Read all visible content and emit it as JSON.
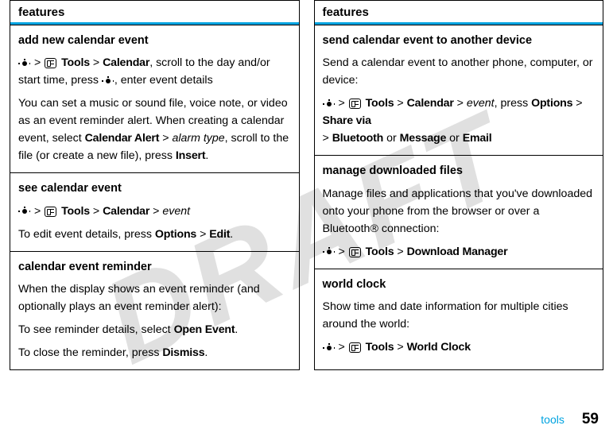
{
  "watermark": "DRAFT",
  "left": {
    "header": "features",
    "sections": [
      {
        "title": "add new calendar event",
        "paras": [
          {
            "type": "path1",
            "t1": "Tools",
            "t2": "Calendar",
            "after": ", scroll to the day and/or start time, press ",
            "navAfter": true,
            "tail": ", enter event details"
          },
          {
            "type": "plain",
            "text": "You can set a music or sound file, voice note, or video as an event reminder alert. When creating a calendar event, select ",
            "b1": "Calendar Alert",
            "mid": " > ",
            "i1": "alarm type",
            "after": ", scroll to the file (or create a new file), press ",
            "b2": "Insert",
            "end": "."
          }
        ]
      },
      {
        "title": "see calendar event",
        "paras": [
          {
            "type": "path2",
            "t1": "Tools",
            "t2": "Calendar",
            "t3": "",
            "i3": "event"
          },
          {
            "type": "plain2",
            "text": "To edit event details, press ",
            "b1": "Options",
            "mid": " > ",
            "b2": "Edit",
            "end": "."
          }
        ]
      },
      {
        "title": "calendar event reminder",
        "paras": [
          {
            "type": "text",
            "text": "When the display shows an event reminder (and optionally plays an event reminder alert):"
          },
          {
            "type": "plain3",
            "text": "To see reminder details, select ",
            "b1": "Open Event",
            "end": "."
          },
          {
            "type": "plain3",
            "text": "To close the reminder, press ",
            "b1": "Dismiss",
            "end": "."
          }
        ]
      }
    ]
  },
  "right": {
    "header": "features",
    "sections": [
      {
        "title": "send calendar event to another device",
        "paras": [
          {
            "type": "text",
            "text": "Send a calendar event to another phone, computer, or device:"
          },
          {
            "type": "sendpath",
            "t1": "Tools",
            "t2": "Calendar",
            "i3": "event",
            "after": ", press ",
            "b1": "Options",
            "mid": " > ",
            "b2": "Share via",
            "line2start": "> ",
            "b3": "Bluetooth",
            "or1": " or ",
            "b4": "Message",
            "or2": " or ",
            "b5": "Email"
          }
        ]
      },
      {
        "title": "manage downloaded files",
        "paras": [
          {
            "type": "text",
            "text": "Manage files and applications that you've downloaded onto your phone from the browser or over a Bluetooth® connection:"
          },
          {
            "type": "simplepath",
            "t1": "Tools",
            "t2": "Download Manager"
          }
        ]
      },
      {
        "title": "world clock",
        "paras": [
          {
            "type": "text",
            "text": "Show time and date information for multiple cities around the world:"
          },
          {
            "type": "simplepath",
            "t1": "Tools",
            "t2": "World Clock"
          }
        ]
      }
    ]
  },
  "footer": {
    "label": "tools",
    "page": "59"
  }
}
